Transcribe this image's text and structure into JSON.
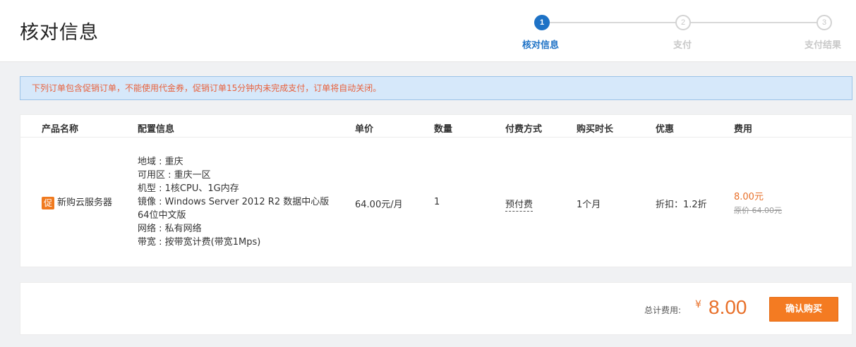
{
  "header": {
    "title": "核对信息",
    "steps": [
      {
        "number": "1",
        "label": "核对信息",
        "state": "active"
      },
      {
        "number": "2",
        "label": "支付",
        "state": "inactive"
      },
      {
        "number": "3",
        "label": "支付结果",
        "state": "inactive"
      }
    ]
  },
  "notice": "下列订单包含促销订单，不能使用代金券，促销订单15分钟内未完成支付，订单将自动关闭。",
  "table": {
    "columns": [
      "产品名称",
      "配置信息",
      "单价",
      "数量",
      "付费方式",
      "购买时长",
      "优惠",
      "费用"
    ],
    "row": {
      "badge": "促",
      "product": "新购云服务器",
      "config": [
        "地域 : 重庆",
        "可用区 : 重庆一区",
        "机型 : 1核CPU、1G内存",
        "镜像 : Windows Server 2012 R2 数据中心版",
        "64位中文版",
        "网络 : 私有网络",
        "带宽 : 按带宽计费(带宽1Mps)"
      ],
      "unit_price": "64.00元/月",
      "quantity": "1",
      "pay_type": "预付费",
      "duration": "1个月",
      "discount": "折扣：1.2折",
      "fee": "8.00元",
      "original_fee": "原价 64.00元"
    }
  },
  "footer": {
    "total_label": "总计费用:",
    "currency": "¥",
    "total_amount": "8.00",
    "confirm_label": "确认购买"
  },
  "colors": {
    "accent": "#1e72c6",
    "price": "#e8702a",
    "button": "#f47b22",
    "notice_bg": "#d6e8fa"
  }
}
